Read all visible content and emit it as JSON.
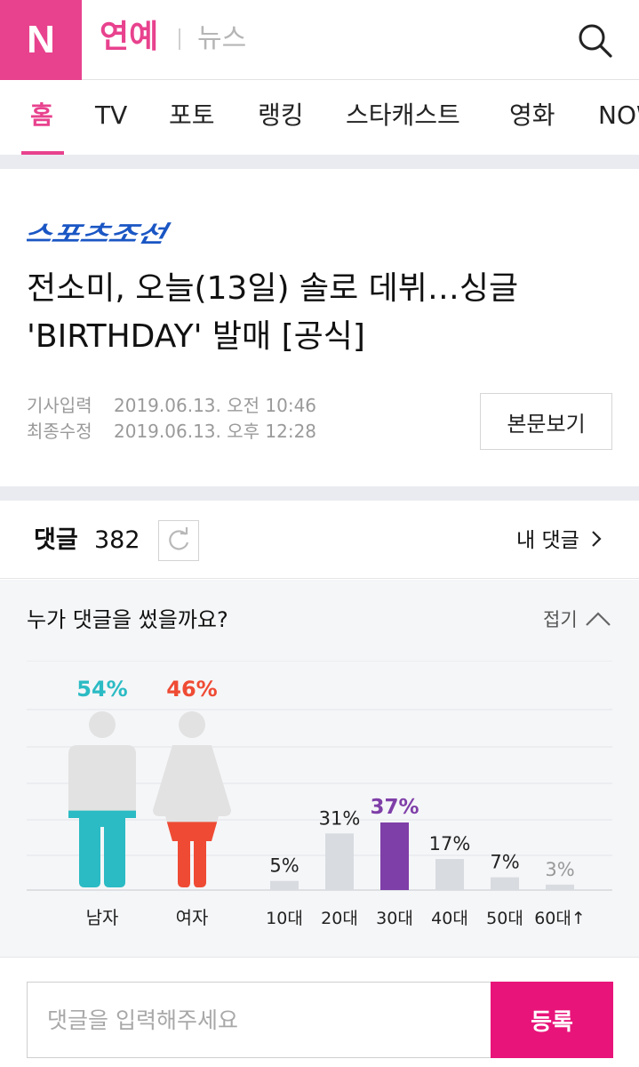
{
  "header": {
    "logo": "N",
    "section": "연예",
    "subsection": "뉴스"
  },
  "nav": {
    "items": [
      {
        "label": "홈",
        "active": true
      },
      {
        "label": "TV"
      },
      {
        "label": "포토"
      },
      {
        "label": "랭킹"
      },
      {
        "label": "스타캐스트"
      },
      {
        "label": "영화"
      },
      {
        "label": "NOW"
      }
    ]
  },
  "article": {
    "press": "스포츠조선",
    "headline": "전소미, 오늘(13일) 솔로 데뷔…싱글 'BIRTHDAY' 발매 [공식]",
    "published_label": "기사입력",
    "published": "2019.06.13. 오전 10:46",
    "modified_label": "최종수정",
    "modified": "2019.06.13. 오후 12:28",
    "view_button": "본문보기"
  },
  "comments": {
    "label": "댓글",
    "count": "382",
    "my_comments": "내 댓글",
    "stats_title": "누가 댓글을 썼을까요?",
    "fold_label": "접기",
    "input_placeholder": "댓글을 입력해주세요",
    "submit_label": "등록"
  },
  "chart_data": [
    {
      "type": "pictogram",
      "categories": [
        "남자",
        "여자"
      ],
      "values": [
        54,
        46
      ],
      "value_labels": [
        "54%",
        "46%"
      ],
      "colors": [
        "#2bbbc4",
        "#ef4b34"
      ]
    },
    {
      "type": "bar",
      "categories": [
        "10대",
        "20대",
        "30대",
        "40대",
        "50대",
        "60대↑"
      ],
      "values": [
        5,
        31,
        37,
        17,
        7,
        3
      ],
      "value_labels": [
        "5%",
        "31%",
        "37%",
        "17%",
        "7%",
        "3%"
      ],
      "highlight": "30대",
      "highlight_color": "#7f3fa8",
      "bar_color": "#d8dbe0",
      "grid": true
    }
  ]
}
